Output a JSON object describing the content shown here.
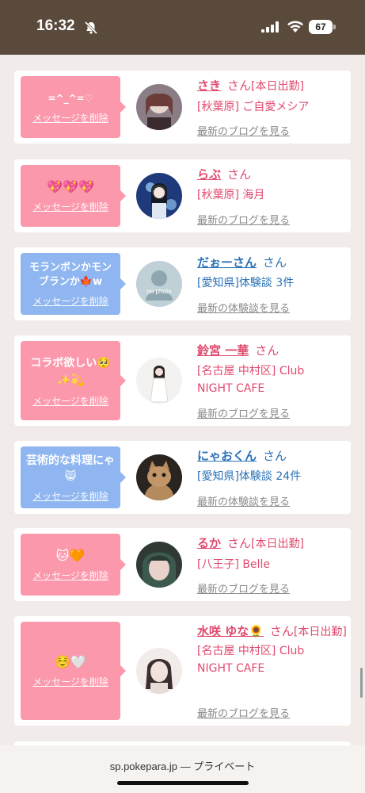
{
  "status_bar": {
    "time": "16:32",
    "battery_level": "67",
    "icons": [
      "bell-muted-icon",
      "signal-icon",
      "wifi-icon",
      "battery-icon"
    ]
  },
  "delete_label": "メッセージを削除",
  "honorific": "さん",
  "cards": [
    {
      "bubble_color": "pink",
      "bubble_text": "=^_^=♡",
      "name": "さき",
      "tag": "[本日出勤]",
      "detail_lines": [
        "[秋葉原] ご自愛メシア"
      ],
      "link": "最新のブログを見る",
      "kind": "pink"
    },
    {
      "bubble_color": "pink",
      "bubble_text": "💖💖💖",
      "name": "らぶ",
      "tag": "",
      "detail_lines": [
        "[秋葉原] 海月"
      ],
      "link": "最新のブログを見る",
      "kind": "pink"
    },
    {
      "bubble_color": "blue",
      "bubble_text": "モランボンかモンブランか🍁w",
      "name": "だぉーさん",
      "tag": "",
      "detail_lines": [
        "[愛知県]体験談 3件"
      ],
      "link": "最新の体験談を見る",
      "kind": "blue",
      "avatar_label": "no photo"
    },
    {
      "bubble_color": "pink",
      "bubble_text": "コラボ欲しい🥺✨💫",
      "name": "鈴宮 一華",
      "tag": "",
      "detail_lines": [
        "[名古屋 中村区] Club",
        "NIGHT CAFE"
      ],
      "link": "最新のブログを見る",
      "kind": "pink"
    },
    {
      "bubble_color": "blue",
      "bubble_text": "芸術的な料理にゃ😸",
      "name": "にゃおくん",
      "tag": "",
      "detail_lines": [
        "[愛知県]体験談 24件"
      ],
      "link": "最新の体験談を見る",
      "kind": "blue"
    },
    {
      "bubble_color": "pink",
      "bubble_text": "🐱🧡",
      "name": "るか",
      "tag": "[本日出勤]",
      "detail_lines": [
        "[八王子] Belle"
      ],
      "link": "最新のブログを見る",
      "kind": "pink"
    },
    {
      "bubble_color": "pink",
      "bubble_text": "☺️🤍",
      "name": "水咲 ゆな🌻",
      "tag": "[本日出勤]",
      "detail_lines": [
        "[名古屋 中村区] Club",
        "NIGHT CAFE"
      ],
      "link": "最新のブログを見る",
      "kind": "pink"
    }
  ],
  "browser": {
    "url": "sp.pokepara.jp — プライベート"
  }
}
